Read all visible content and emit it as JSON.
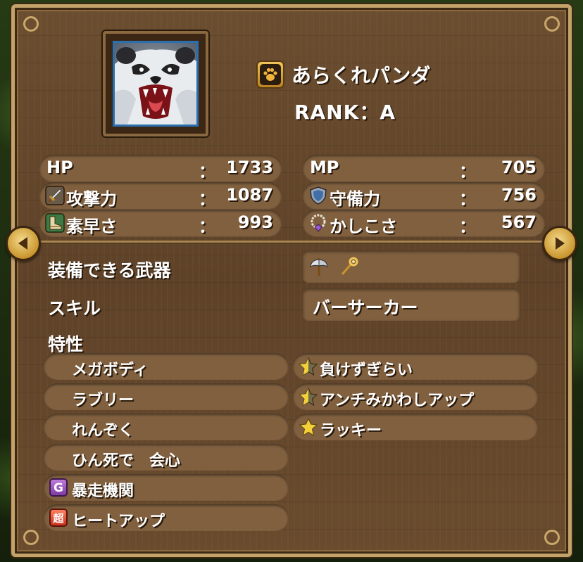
{
  "monster": {
    "name": "あらくれパンダ",
    "rank": "RANK：A",
    "family_icon": "paw-icon"
  },
  "stats": [
    {
      "key": "hp",
      "label": "HP",
      "value": "1733",
      "icon": ""
    },
    {
      "key": "mp",
      "label": "MP",
      "value": "705",
      "icon": ""
    },
    {
      "key": "attack",
      "label": "攻撃力",
      "value": "1087",
      "icon": "sword-icon"
    },
    {
      "key": "defense",
      "label": "守備力",
      "value": "756",
      "icon": "shield-icon"
    },
    {
      "key": "agility",
      "label": "素早さ",
      "value": "993",
      "icon": "boot-icon"
    },
    {
      "key": "wisdom",
      "label": "かしこさ",
      "value": "567",
      "icon": "ring-icon"
    }
  ],
  "stat_separator": "：",
  "equipment": {
    "label": "装備できる武器",
    "weapons": [
      "axe-icon",
      "staff-icon"
    ]
  },
  "skill": {
    "label": "スキル",
    "value": "バーサーカー"
  },
  "traits": {
    "label": "特性",
    "left": [
      {
        "text": "メガボディ",
        "badge": ""
      },
      {
        "text": "ラブリー",
        "badge": ""
      },
      {
        "text": "れんぞく",
        "badge": ""
      },
      {
        "text": "ひん死で　会心",
        "badge": ""
      },
      {
        "text": "暴走機関",
        "badge": "G"
      },
      {
        "text": "ヒートアップ",
        "badge": "超"
      }
    ],
    "right": [
      {
        "text": "負けずぎらい",
        "icon": "star-half-icon"
      },
      {
        "text": "アンチみかわしアップ",
        "icon": "star-half-icon"
      },
      {
        "text": "ラッキー",
        "icon": "star-icon"
      }
    ]
  },
  "colors": {
    "wood": "#6b4d2f",
    "pill": "#80603f",
    "frame": "#c4a36a",
    "text": "#ffffff",
    "portrait_border": "#2a6fb0"
  }
}
